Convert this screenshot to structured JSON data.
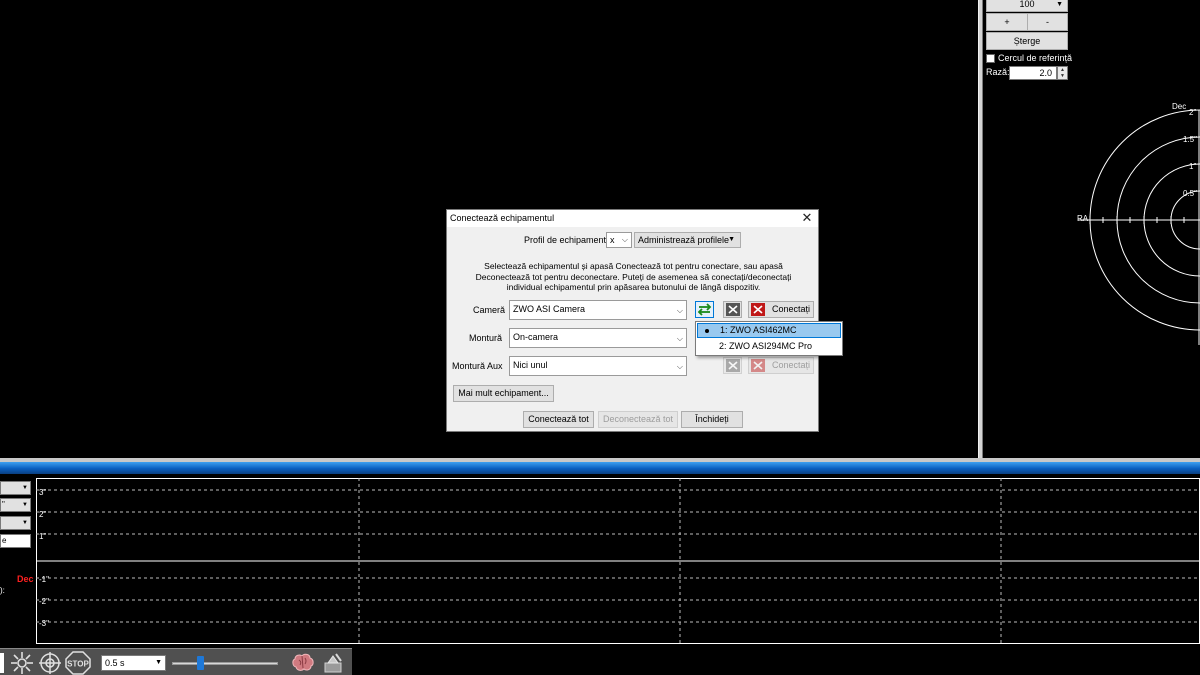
{
  "right_panel": {
    "top_value": "100",
    "plus_label": "+",
    "minus_label": "-",
    "clear_label": "Șterge",
    "ref_circle_label": "Cercul de referință",
    "radius_label": "Rază:",
    "radius_value": "2.0",
    "target": {
      "dec_label": "Dec",
      "ra_label": "RA",
      "ring_labels": [
        "2\"",
        "1.5\"",
        "1\"",
        "0.5\""
      ]
    }
  },
  "graph": {
    "left_combos": [
      "",
      "\"",
      "",
      "e"
    ],
    "dec_label": "Dec",
    "side_label": "):",
    "y_labels": [
      "3\"",
      "2\"",
      "1\"",
      "-1\"",
      "-2\"",
      "-3\""
    ]
  },
  "toolbar": {
    "exposure_value": "0.5 s",
    "gamma_fraction": 0.25,
    "stop_label": "STOP"
  },
  "dialog": {
    "title": "Conectează echipamentul",
    "profile_label": "Profil de echipament",
    "profile_value": "x",
    "manage_profiles_label": "Administrează profilele",
    "instructions": [
      "Selectează echipamentul și apasă Conectează tot pentru conectare, sau apasă",
      "Deconectează tot pentru deconectare. Puteți de asemenea să conectați/deconectați",
      "individual echipamentul prin apăsarea butonului de lângă dispozitiv."
    ],
    "camera_label": "Cameră",
    "camera_value": "ZWO ASI Camera",
    "mount_label": "Montură",
    "mount_value": "On-camera",
    "aux_mount_label": "Montură Aux",
    "aux_mount_value": "Nici unul",
    "connect_label": "Conectați",
    "more_equipment_label": "Mai mult echipament...",
    "connect_all_label": "Conectează tot",
    "disconnect_all_label": "Deconectează tot",
    "close_label": "Închideți"
  },
  "camera_popup": {
    "items": [
      "1: ZWO ASI462MC",
      "2: ZWO ASI294MC Pro"
    ],
    "selected_index": 0
  },
  "colors": {
    "accent_blue": "#0a5fc0",
    "dec_red": "#ff2020",
    "popup_highlight": "#99c9ef"
  }
}
